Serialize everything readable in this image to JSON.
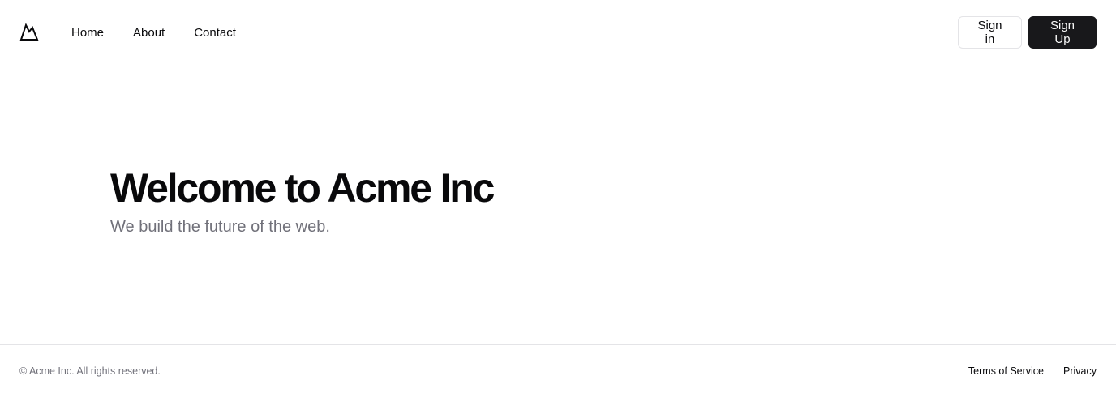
{
  "header": {
    "logo_icon": "mountain-icon",
    "nav": {
      "home": "Home",
      "about": "About",
      "contact": "Contact"
    },
    "sign_in_label": "Sign in",
    "sign_up_label": "Sign Up"
  },
  "hero": {
    "title": "Welcome to Acme Inc",
    "subtitle": "We build the future of the web."
  },
  "footer": {
    "copyright": "© Acme Inc. All rights reserved.",
    "links": {
      "terms": "Terms of Service",
      "privacy": "Privacy"
    }
  },
  "colors": {
    "background": "#ffffff",
    "text": "#09090b",
    "muted": "#71717a",
    "border": "#e4e4e7",
    "primary_button": "#18181b"
  }
}
